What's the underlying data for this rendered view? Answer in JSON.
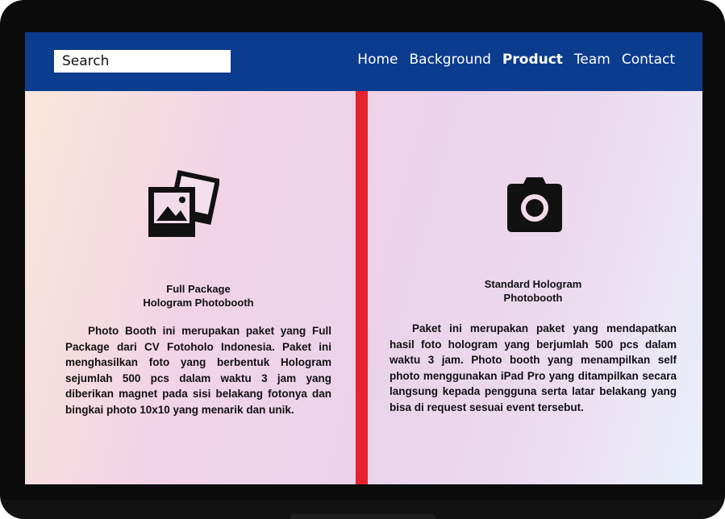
{
  "nav": {
    "search_text": "Search",
    "links": [
      "Home",
      "Background",
      "Product",
      "Team",
      "Contact"
    ],
    "active": "Product"
  },
  "products": [
    {
      "icon": "photos-icon",
      "title": "Full Package\nHologram Photobooth",
      "description": "Photo Booth ini merupakan paket yang Full Package dari CV Fotoholo Indonesia. Paket ini menghasilkan foto yang berbentuk Hologram sejumlah 500 pcs dalam waktu 3 jam yang diberikan magnet pada sisi belakang fotonya dan bingkai photo 10x10 yang menarik dan unik."
    },
    {
      "icon": "camera-icon",
      "title": "Standard Hologram\nPhotobooth",
      "description": "Paket ini merupakan paket yang mendapatkan hasil foto hologram yang berjumlah 500 pcs dalam waktu 3 jam. Photo booth yang menampilkan self photo menggunakan iPad Pro yang ditampilkan secara langsung kepada pengguna serta latar belakang yang bisa di request sesuai event tersebut."
    }
  ],
  "colors": {
    "navbar": "#0c3c8e",
    "divider": "#e4232e",
    "frame": "#0b0b0c"
  }
}
